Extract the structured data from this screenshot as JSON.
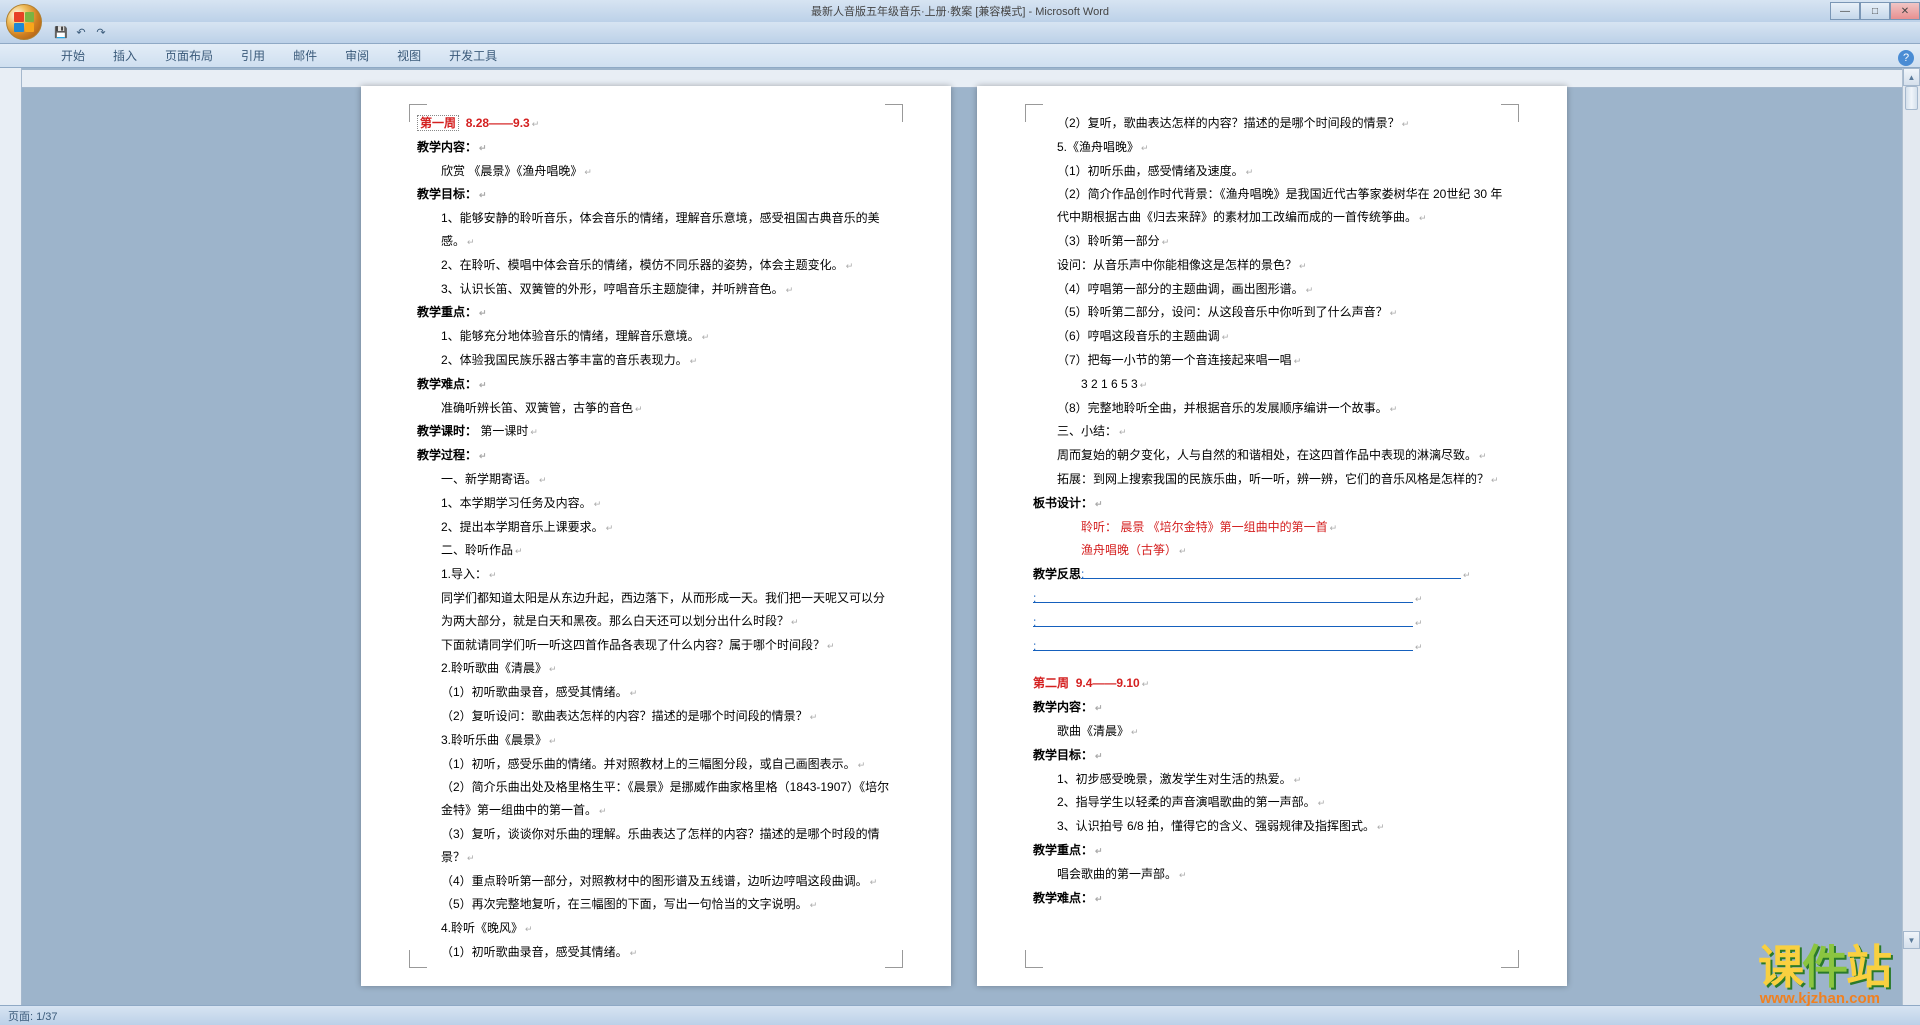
{
  "window": {
    "title": "最新人音版五年级音乐·上册·教案 [兼容模式] - Microsoft Word",
    "min": "—",
    "max": "□",
    "close": "✕"
  },
  "qat": {
    "save": "💾",
    "undo": "↶",
    "redo": "↷"
  },
  "tabs": {
    "start": "开始",
    "insert": "插入",
    "layout": "页面布局",
    "ref": "引用",
    "mail": "邮件",
    "review": "审阅",
    "view": "视图",
    "dev": "开发工具"
  },
  "page1": {
    "week_title": "第一周",
    "week_date": "8.28——9.3",
    "h_content": "教学内容：",
    "l_content": "欣赏 《晨景》《渔舟唱晚》",
    "h_goal": "教学目标：",
    "g1": "1、能够安静的聆听音乐，体会音乐的情绪，理解音乐意境，感受祖国古典音乐的美感。",
    "g2": "2、在聆听、模唱中体会音乐的情绪，模仿不同乐器的姿势，体会主题变化。",
    "g3": "3、认识长笛、双簧管的外形，哼唱音乐主题旋律，并听辨音色。",
    "h_key": "教学重点：",
    "k1": "1、能够充分地体验音乐的情绪，理解音乐意境。",
    "k2": "2、体验我国民族乐器古筝丰富的音乐表现力。",
    "h_diff": "教学难点：",
    "d1": "准确听辨长笛、双簧管，古筝的音色",
    "h_period": "教学课时：",
    "period_v": "第一课时",
    "h_process": "教学过程：",
    "p1": "一、新学期寄语。",
    "p2": "1、本学期学习任务及内容。",
    "p3": "2、提出本学期音乐上课要求。",
    "p4": "二、聆听作品",
    "p5": "1.导入：",
    "p6": "同学们都知道太阳是从东边升起，西边落下，从而形成一天。我们把一天呢又可以分为两大部分，就是白天和黑夜。那么白天还可以划分出什么时段？",
    "p7": "下面就请同学们听一听这四首作品各表现了什么内容？属于哪个时间段？",
    "p8": "2.聆听歌曲《清晨》",
    "p9": "（1）初听歌曲录音，感受其情绪。",
    "p10": "（2）复听设问：歌曲表达怎样的内容？描述的是哪个时间段的情景？",
    "p11": "3.聆听乐曲《晨景》",
    "p12": "（1）初听，感受乐曲的情绪。并对照教材上的三幅图分段，或自己画图表示。",
    "p13": "（2）简介乐曲出处及格里格生平：《晨景》是挪威作曲家格里格（1843-1907）《培尔金特》第一组曲中的第一首。",
    "p14": "（3）复听，谈谈你对乐曲的理解。乐曲表达了怎样的内容？描述的是哪个时段的情景？",
    "p15": "（4）重点聆听第一部分，对照教材中的图形谱及五线谱，边听边哼唱这段曲调。",
    "p16": "（5）再次完整地复听，在三幅图的下面，写出一句恰当的文字说明。",
    "p17": "4.聆听《晚风》",
    "p18": "（1）初听歌曲录音，感受其情绪。"
  },
  "page2": {
    "q1": "（2）复听，歌曲表达怎样的内容？描述的是哪个时间段的情景？",
    "q2": "5.《渔舟唱晚》",
    "q3": "（1）初听乐曲，感受情绪及速度。",
    "q4": "（2）简介作品创作时代背景：《渔舟唱晚》是我国近代古筝家娄树华在 20世纪 30 年代中期根据古曲《归去来辞》的素材加工改编而成的一首传统筝曲。",
    "q5": "（3）聆听第一部分",
    "q6": "设问：从音乐声中你能相像这是怎样的景色？",
    "q7": "（4）哼唱第一部分的主题曲调，画出图形谱。",
    "q8": "（5）聆听第二部分，设问：从这段音乐中你听到了什么声音？",
    "q9": "（6）哼唱这段音乐的主题曲调",
    "q10": "（7）把每一小节的第一个音连接起来唱一唱",
    "q11_nums": "3    2    1    6    5    3",
    "q12": "（8）完整地聆听全曲，并根据音乐的发展顺序编讲一个故事。",
    "q13": "三、小结：",
    "q14": "周而复始的朝夕变化，人与自然的和谐相处，在这四首作品中表现的淋漓尽致。",
    "q15": "拓展：到网上搜索我国的民族乐曲，听一听，辨一辨，它们的音乐风格是怎样的？",
    "h_board": "板书设计：",
    "b1": "聆听：  晨景    《培尔金特》第一组曲中的第一首",
    "b2": "渔舟唱晚（古筝）",
    "h_reflect": "教学反思",
    "colon": ":",
    "week2_title": "第二周",
    "week2_date": "9.4——9.10",
    "h2_content": "教学内容：",
    "c2_1": "歌曲《清晨》",
    "h2_goal": "教学目标：",
    "g2_1": "1、初步感受晚景，激发学生对生活的热爱。",
    "g2_2": "2、指导学生以轻柔的声音演唱歌曲的第一声部。",
    "g2_3": "3、认识拍号 6/8 拍，懂得它的含义、强弱规律及指挥图式。",
    "h2_key": "教学重点：",
    "k2_1": "唱会歌曲的第一声部。",
    "h2_diff": "教学难点："
  },
  "statusbar": {
    "page": "页面: 1/37"
  },
  "watermark": {
    "t1": "课",
    "t2": "件",
    "t3": "站",
    "url": "www.kjzhan.com"
  },
  "scroll": {
    "up": "▲",
    "down": "▼"
  }
}
